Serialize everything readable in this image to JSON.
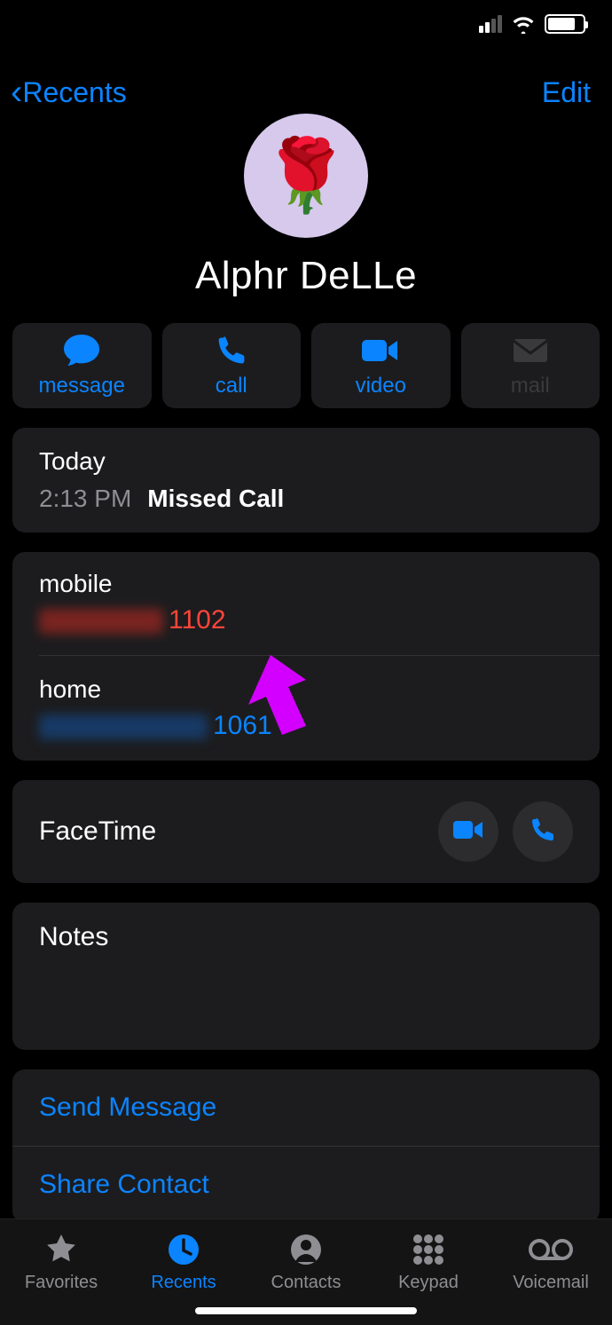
{
  "nav": {
    "back_label": "Recents",
    "edit_label": "Edit"
  },
  "contact": {
    "name": "Alphr DeLLe",
    "avatar_emoji": "🌹"
  },
  "actions": {
    "message": "message",
    "call": "call",
    "video": "video",
    "mail": "mail"
  },
  "call_log": {
    "day": "Today",
    "time": "2:13 PM",
    "status": "Missed Call"
  },
  "phones": {
    "mobile_label": "mobile",
    "mobile_suffix": "1102",
    "home_label": "home",
    "home_suffix": "1061"
  },
  "facetime": {
    "label": "FaceTime"
  },
  "notes": {
    "label": "Notes"
  },
  "links": {
    "send_message": "Send Message",
    "share_contact": "Share Contact"
  },
  "tabs": {
    "favorites": "Favorites",
    "recents": "Recents",
    "contacts": "Contacts",
    "keypad": "Keypad",
    "voicemail": "Voicemail"
  },
  "colors": {
    "accent": "#0b84ff",
    "danger": "#ff453a",
    "card": "#1c1c1e",
    "annotation": "#d400ff"
  }
}
